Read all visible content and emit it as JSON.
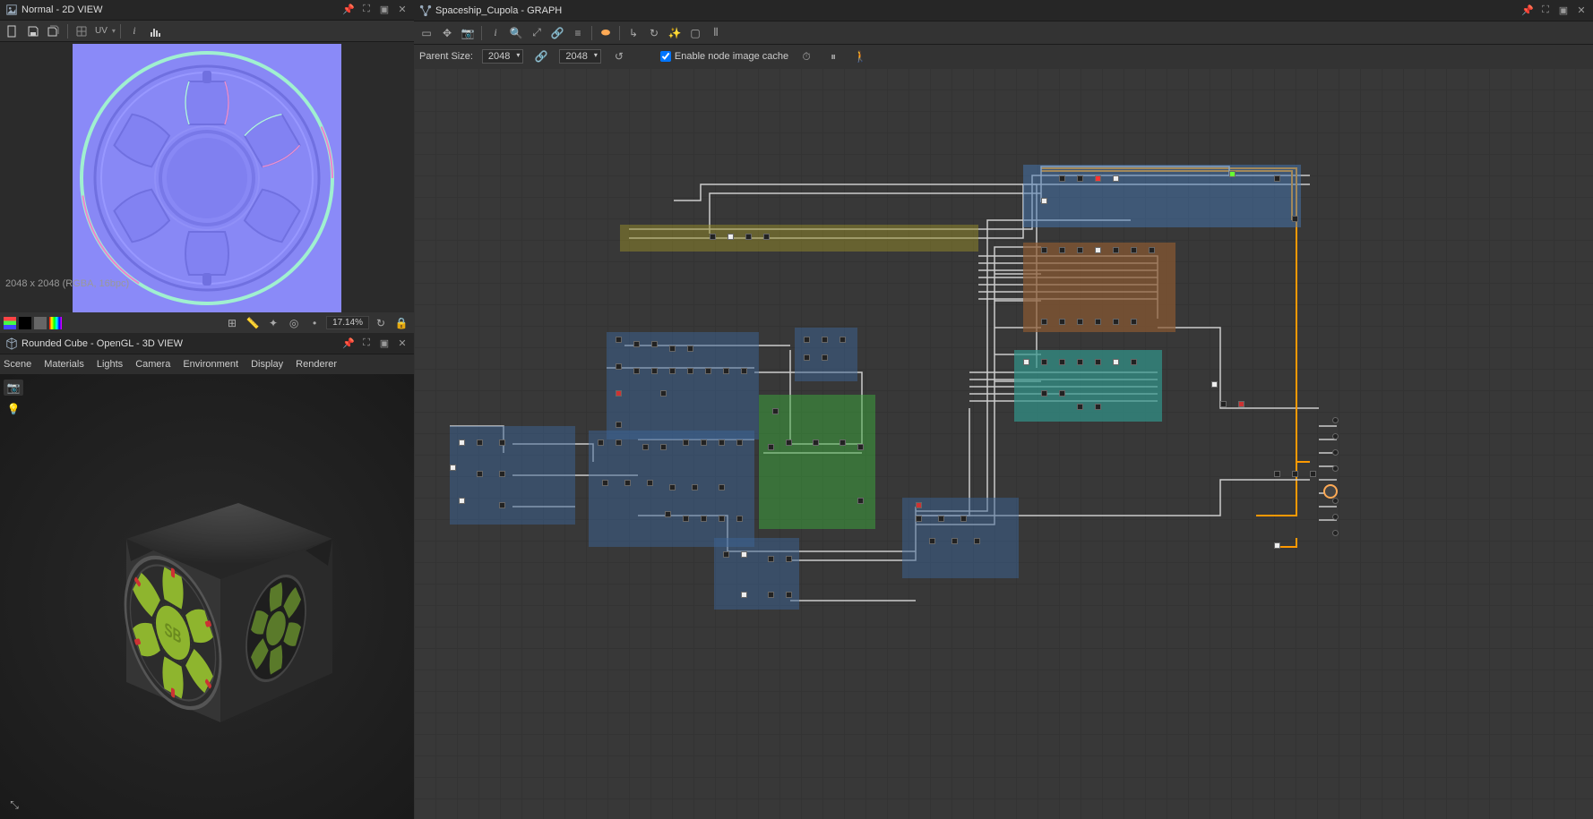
{
  "panel2d": {
    "title": "Normal - 2D VIEW",
    "info": "2048 x 2048 (RGBA, 16bpc)",
    "uv_label": "UV",
    "zoom": "17.14%"
  },
  "panel3d": {
    "title": "Rounded Cube - OpenGL - 3D VIEW",
    "menus": [
      "Scene",
      "Materials",
      "Lights",
      "Camera",
      "Environment",
      "Display",
      "Renderer"
    ],
    "logo": "SB"
  },
  "graph": {
    "title": "Spaceship_Cupola - GRAPH",
    "parent_size_label": "Parent Size:",
    "size1": "2048",
    "size2": "2048",
    "cache_label": "Enable node image cache"
  }
}
